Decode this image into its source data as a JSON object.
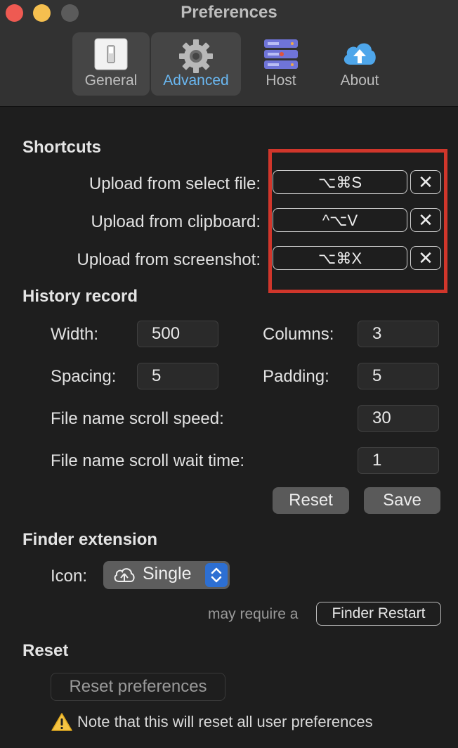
{
  "window": {
    "title": "Preferences"
  },
  "tabs": [
    {
      "label": "General",
      "icon": "switch-icon"
    },
    {
      "label": "Advanced",
      "icon": "gear-icon",
      "selected": true
    },
    {
      "label": "Host",
      "icon": "server-icon"
    },
    {
      "label": "About",
      "icon": "cloud-upload-icon"
    }
  ],
  "shortcuts": {
    "title": "Shortcuts",
    "items": [
      {
        "label": "Upload from select file:",
        "value": "⌥⌘S"
      },
      {
        "label": "Upload from clipboard:",
        "value": "^⌥V"
      },
      {
        "label": "Upload from screenshot:",
        "value": "⌥⌘X"
      }
    ],
    "clear_symbol": "✕"
  },
  "history": {
    "title": "History record",
    "width_label": "Width:",
    "width_value": "500",
    "columns_label": "Columns:",
    "columns_value": "3",
    "spacing_label": "Spacing:",
    "spacing_value": "5",
    "padding_label": "Padding:",
    "padding_value": "5",
    "scroll_speed_label": "File name scroll speed:",
    "scroll_speed_value": "30",
    "wait_time_label": "File name scroll wait time:",
    "wait_time_value": "1",
    "reset_label": "Reset",
    "save_label": "Save"
  },
  "finder": {
    "title": "Finder extension",
    "icon_label": "Icon:",
    "icon_value": "Single",
    "restart_hint": "may require a",
    "restart_label": "Finder Restart"
  },
  "reset": {
    "title": "Reset",
    "button_label": "Reset preferences",
    "note": "Note that this will reset all user preferences"
  },
  "colors": {
    "accent": "#6ab8f2",
    "highlight_box": "#d0362b",
    "popup_stepper": "#2d6fd2"
  }
}
